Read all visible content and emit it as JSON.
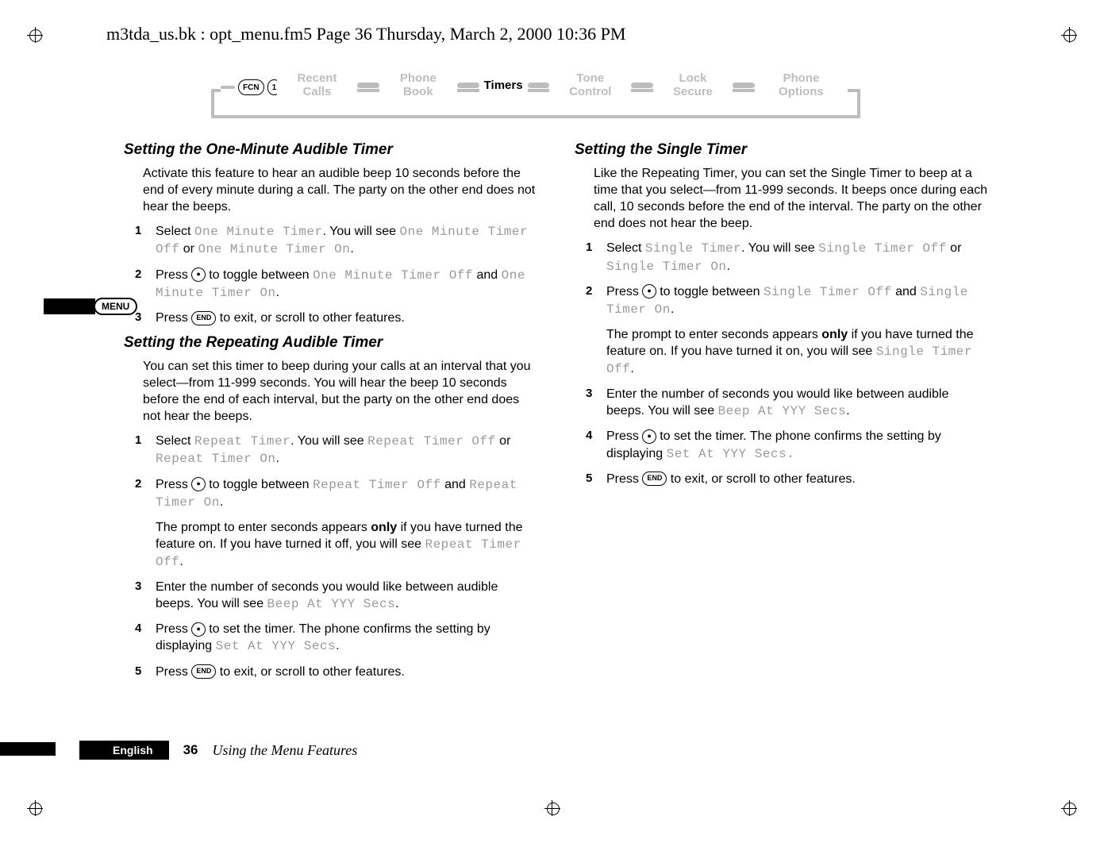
{
  "header": "m3tda_us.bk : opt_menu.fm5  Page 36  Thursday, March 2, 2000  10:36 PM",
  "nav": {
    "key_fcn": "FCN",
    "key_1": "1",
    "items": [
      "Recent Calls",
      "Phone Book",
      "Timers",
      "Tone Control",
      "Lock Secure",
      "Phone Options"
    ],
    "active_index": 2
  },
  "menu_tab": "MENU",
  "left": {
    "h1": "Setting the One-Minute Audible Timer",
    "p1": "Activate this feature to hear an audible beep 10 seconds before the end of every minute during a call. The party on the other end does not hear the beeps.",
    "s1_pre": "Select ",
    "s1_lcd1": "One Minute Timer",
    "s1_mid": ". You will see ",
    "s1_lcd2": "One Minute Timer Off",
    "s1_or": " or ",
    "s1_lcd3": "One Minute Timer On",
    "s1_end": ".",
    "s2_pre": "Press ",
    "s2_key": "●",
    "s2_mid": " to toggle between ",
    "s2_lcd1": "One Minute Timer Off",
    "s2_and": " and ",
    "s2_lcd2": "One Minute Timer On",
    "s2_end": ".",
    "s3_pre": "Press ",
    "s3_key": "END",
    "s3_end": " to exit, or scroll to other features.",
    "h2": "Setting the Repeating Audible Timer",
    "p2": "You can set this timer to beep during your calls at an interval that you select—from 11-999 seconds. You will hear the beep 10 seconds before the end of each interval, but the party on the other end does not hear the beeps.",
    "r1_pre": "Select ",
    "r1_lcd1": "Repeat Timer",
    "r1_mid": ". You will see ",
    "r1_lcd2": "Repeat Timer Off",
    "r1_or": " or ",
    "r1_lcd3": "Repeat Timer On",
    "r1_end": ".",
    "r2_pre": "Press ",
    "r2_key": "●",
    "r2_mid": " to toggle between ",
    "r2_lcd1": "Repeat Timer Off",
    "r2_and": " and ",
    "r2_lcd2": "Repeat Timer On",
    "r2_end": ".",
    "r_aux_a": "The prompt to enter seconds appears ",
    "r_aux_b": "only",
    "r_aux_c": " if you have turned the feature on. If you have turned it off, you will see ",
    "r_aux_lcd": "Repeat Timer Off",
    "r_aux_end": ".",
    "r3_pre": "Enter the number of seconds you would like between audible beeps. You will see ",
    "r3_lcd": "Beep At YYY Secs",
    "r3_end": ".",
    "r4_pre": "Press ",
    "r4_key": "●",
    "r4_mid": " to set the timer. The phone confirms the setting by displaying ",
    "r4_lcd": "Set At YYY Secs",
    "r4_end": ".",
    "r5_pre": "Press ",
    "r5_key": "END",
    "r5_end": " to exit, or scroll to other features."
  },
  "right": {
    "h1": "Setting the Single Timer",
    "p1": "Like the Repeating Timer, you can set the Single Timer to beep at a time that you select—from 11-999 seconds. It beeps once during each call, 10 seconds before the end of the interval. The party on the other end does not hear the beep.",
    "s1_pre": "Select ",
    "s1_lcd1": "Single Timer",
    "s1_mid": ". You will see ",
    "s1_lcd2": "Single Timer Off",
    "s1_or": " or ",
    "s1_lcd3": "Single Timer On",
    "s1_end": ".",
    "s2_pre": "Press ",
    "s2_key": "●",
    "s2_mid": " to toggle between ",
    "s2_lcd1": "Single Timer Off",
    "s2_and": " and ",
    "s2_lcd2": "Single Timer On",
    "s2_end": ".",
    "aux_a": "The prompt to enter seconds appears ",
    "aux_b": "only",
    "aux_c": " if you have turned the feature on. If you have turned it on, you will see ",
    "aux_lcd": "Single Timer Off",
    "aux_end": ".",
    "s3_pre": "Enter the number of seconds you would like between audible beeps. You will see ",
    "s3_lcd": "Beep At YYY Secs",
    "s3_end": ".",
    "s4_pre": "Press ",
    "s4_key": "●",
    "s4_mid": " to set the timer. The phone confirms the setting by displaying ",
    "s4_lcd": "Set At YYY Secs.",
    "s5_pre": "Press ",
    "s5_key": "END",
    "s5_end": " to exit, or scroll to other features."
  },
  "footer": {
    "lang": "English",
    "page_num": "36",
    "page_title": "Using the Menu Features"
  }
}
